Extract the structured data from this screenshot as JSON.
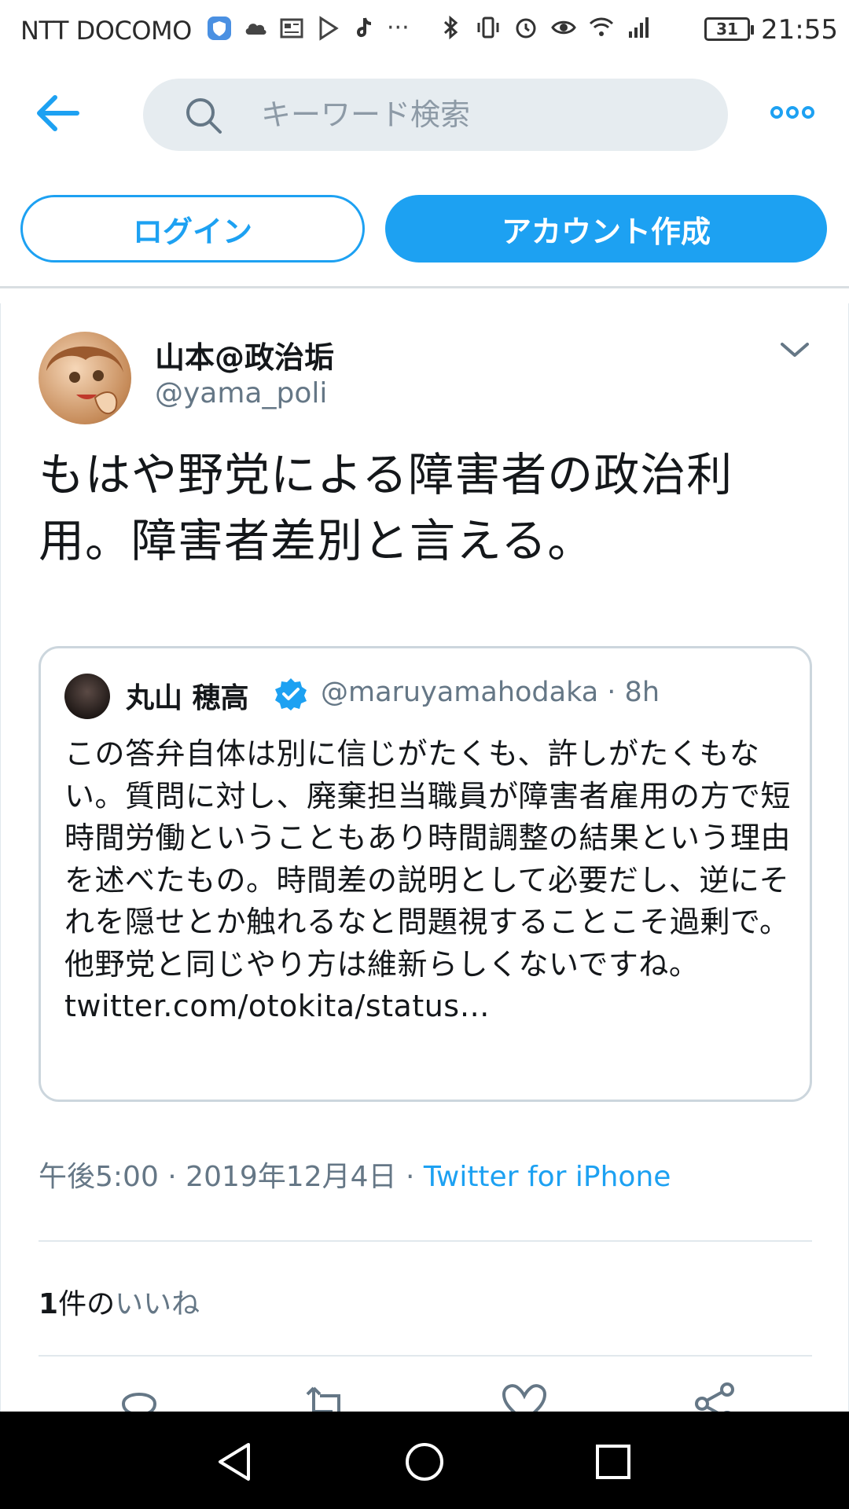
{
  "status_bar": {
    "carrier": "NTT DOCOMO",
    "battery": "31",
    "time": "21:55"
  },
  "header": {
    "search_placeholder": "キーワード検索"
  },
  "auth": {
    "login_label": "ログイン",
    "signup_label": "アカウント作成"
  },
  "tweet": {
    "display_name": "山本@政治垢",
    "handle": "@yama_poli",
    "text": "もはや野党による障害者の政治利用。障害者差別と言える。",
    "quote": {
      "display_name": "丸山 穂高",
      "handle_time": "@maruyamahodaka · 8h",
      "text": "この答弁自体は別に信じがたくも、許しがたくもない。質問に対し、廃棄担当職員が障害者雇用の方で短時間労働ということもあり時間調整の結果という理由を述べたもの。時間差の説明として必要だし、逆にそれを隠せとか触れるなと問題視することこそ過剰で。他野党と同じやり方は維新らしくないですね。",
      "link": "twitter.com/otokita/status…"
    },
    "meta_time": "午後5:00 · 2019年12月4日 · ",
    "source": "Twitter for iPhone",
    "likes_count": "1",
    "likes_mid": "件の",
    "likes_label": "いいね"
  },
  "colors": {
    "accent": "#1da1f2",
    "secondary_text": "#657786",
    "search_bg": "#e6ecf0"
  }
}
